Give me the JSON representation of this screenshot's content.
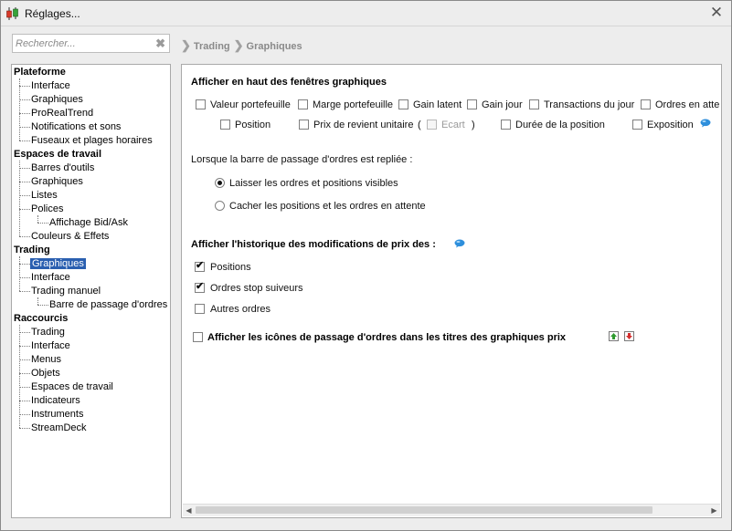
{
  "window": {
    "title": "Réglages..."
  },
  "search": {
    "placeholder": "Rechercher..."
  },
  "breadcrumb": [
    "Trading",
    "Graphiques"
  ],
  "tree": {
    "groups": [
      {
        "label": "Plateforme",
        "children": [
          "Interface",
          "Graphiques",
          "ProRealTrend",
          "Notifications et sons",
          "Fuseaux et plages horaires"
        ]
      },
      {
        "label": "Espaces de travail",
        "children": [
          "Barres d'outils",
          "Graphiques",
          "Listes",
          "Polices",
          "Affichage Bid/Ask",
          "Couleurs & Effets"
        ]
      },
      {
        "label": "Trading",
        "children": [
          "Graphiques",
          "Interface",
          "Trading manuel",
          "Barre de passage d'ordres"
        ]
      },
      {
        "label": "Raccourcis",
        "children": [
          "Trading",
          "Interface",
          "Menus",
          "Objets",
          "Espaces de travail",
          "Indicateurs",
          "Instruments",
          "StreamDeck"
        ]
      }
    ],
    "selected": "Graphiques"
  },
  "panel": {
    "section1": {
      "title": "Afficher en haut des fenêtres graphiques",
      "row1": [
        "Valeur portefeuille",
        "Marge portefeuille",
        "Gain latent",
        "Gain jour",
        "Transactions du jour",
        "Ordres en atte"
      ],
      "row2": [
        "Position",
        "Prix de revient unitaire",
        "Ecart",
        "Durée de la position",
        "Exposition"
      ],
      "paren_open": "(",
      "paren_close": ")"
    },
    "section2": {
      "title": "Lorsque la barre de passage d'ordres est repliée :",
      "options": [
        "Laisser les ordres et positions visibles",
        "Cacher les positions et les ordres en attente"
      ],
      "selected_index": 0
    },
    "section3": {
      "title": "Afficher l'historique des modifications de prix des :",
      "options": [
        {
          "label": "Positions",
          "checked": true
        },
        {
          "label": "Ordres stop suiveurs",
          "checked": true
        },
        {
          "label": "Autres ordres",
          "checked": false
        }
      ]
    },
    "section4": {
      "label": "Afficher les icônes de passage d'ordres dans les titres des graphiques prix"
    }
  },
  "colors": {
    "selection": "#2a5fb0",
    "info_bubble": "#2e8fdc",
    "buy": "#2e9a2e",
    "sell": "#d32f2f"
  }
}
